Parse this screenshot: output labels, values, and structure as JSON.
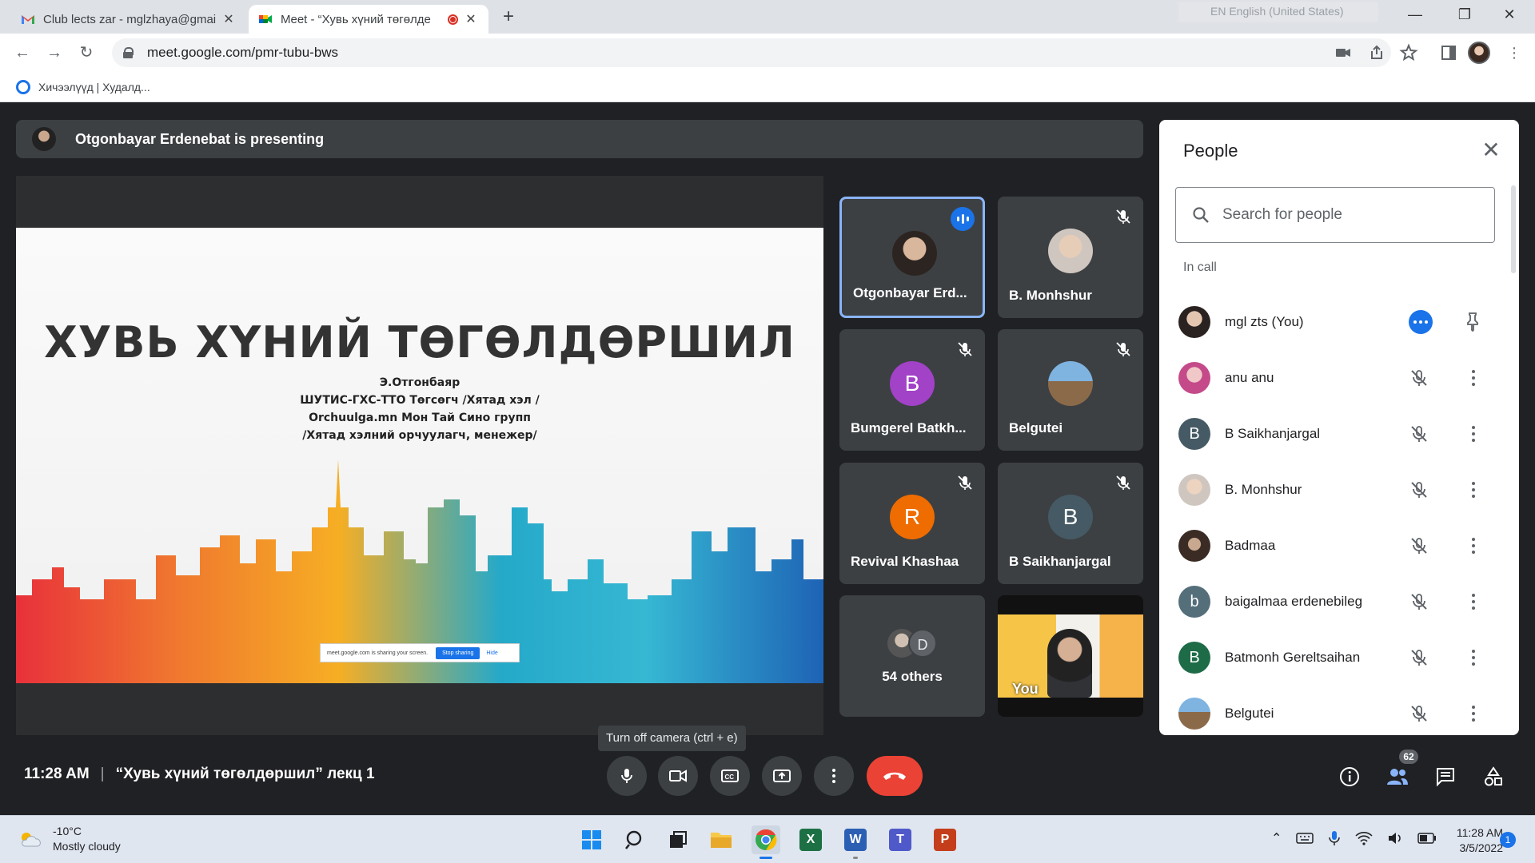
{
  "browser": {
    "tabs": [
      {
        "title": "Club lects zar - mglzhaya@gmail",
        "active": false
      },
      {
        "title": "Meet - “Хувь хүний төгөлде",
        "active": true,
        "recording": true
      }
    ],
    "language_indicator": "EN English (United States)",
    "url": "meet.google.com/pmr-tubu-bws",
    "bookmark": "Хичээлүүд | Худалд..."
  },
  "meet": {
    "presenting_banner": "Otgonbayar Erdenebat is presenting",
    "slide": {
      "title": "ХУВЬ ХҮНИЙ ТӨГӨЛДӨРШИЛ",
      "subtitle_lines": [
        "Э.Отгонбаяр",
        "ШУТИС-ГХС-ТТО Төгсөгч /Хятад хэл /",
        "Orchuulga.mn Мон Тай Сино групп",
        "/Хятад хэлний орчуулагч, менежер/"
      ],
      "share_notice": {
        "text": "meet.google.com is sharing your screen.",
        "stop": "Stop sharing",
        "hide": "Hide"
      }
    },
    "tiles": [
      {
        "name": "Otgonbayar Erd...",
        "speaking": true
      },
      {
        "name": "B. Monhshur",
        "muted": true
      },
      {
        "name": "Bumgerel Batkh...",
        "initial": "B",
        "color": "#a142c7",
        "muted": true
      },
      {
        "name": "Belgutei",
        "muted": true
      },
      {
        "name": "Revival Khashaa",
        "initial": "R",
        "color": "#ef6c00",
        "muted": true
      },
      {
        "name": "B Saikhanjargal",
        "initial": "B",
        "color": "#455a64",
        "muted": true
      }
    ],
    "others_tile": {
      "initial": "D",
      "label": "54 others"
    },
    "self_tile": {
      "label": "You"
    },
    "people_panel": {
      "title": "People",
      "search_placeholder": "Search for people",
      "section_label": "In call",
      "people": [
        {
          "name": "mgl zts (You)",
          "avatar": "photo",
          "self": true
        },
        {
          "name": "anu anu",
          "avatar": "photo-pink"
        },
        {
          "name": "B Saikhanjargal",
          "initial": "B",
          "color": "#455a64"
        },
        {
          "name": "B. Monhshur",
          "avatar": "photo"
        },
        {
          "name": "Badmaa",
          "avatar": "photo-dark"
        },
        {
          "name": "baigalmaa erdenebileg",
          "initial": "b",
          "color": "#546e7a"
        },
        {
          "name": "Batmonh Gereltsaihan",
          "initial": "B",
          "color": "#1e6b48"
        },
        {
          "name": "Belgutei",
          "avatar": "photo-outdoor"
        }
      ]
    },
    "tooltip": "Turn off camera (ctrl + e)",
    "clock": "11:28 AM",
    "meeting_title": "“Хувь хүний төгөлдөршил” лекц 1",
    "people_count": "62"
  },
  "taskbar": {
    "weather_temp": "-10°C",
    "weather_desc": "Mostly cloudy",
    "time": "11:28 AM",
    "date": "3/5/2022",
    "notifications": "1"
  }
}
